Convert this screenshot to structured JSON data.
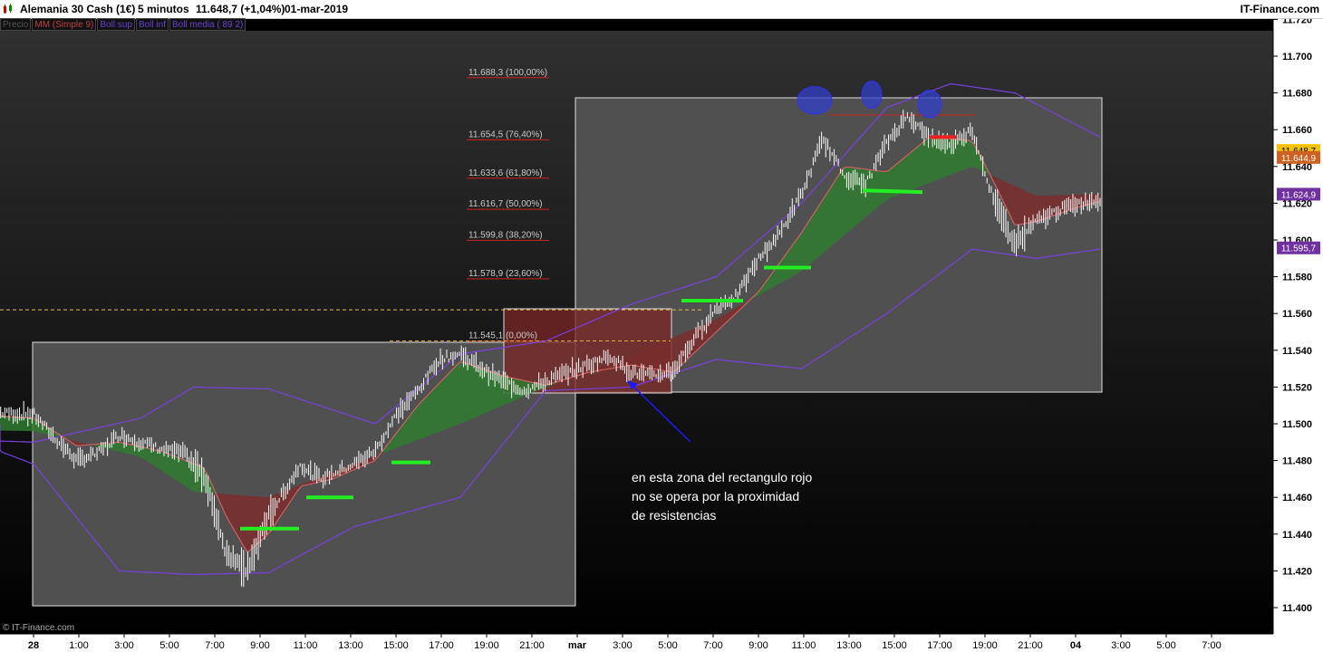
{
  "header": {
    "instrument": "Alemania 30 Cash (1€)",
    "timeframe": "5 minutos",
    "last": "11.648,7 (+1,04%)",
    "date": "01-mar-2019",
    "brand": "IT-Finance.com"
  },
  "legend": [
    {
      "label": "Precio",
      "color": "#555555"
    },
    {
      "label": "MM (Simple 9)",
      "color": "#c04040"
    },
    {
      "label": "Boll sup",
      "color": "#6a3fd0"
    },
    {
      "label": "Boll inf",
      "color": "#6a3fd0"
    },
    {
      "label": "Boll media ( 89 2)",
      "color": "#6a3fd0"
    }
  ],
  "copyright": "© IT-Finance.com",
  "chart_data": {
    "type": "line",
    "x_ticks": [
      "28",
      "1:00",
      "3:00",
      "5:00",
      "7:00",
      "9:00",
      "11:00",
      "13:00",
      "15:00",
      "17:00",
      "19:00",
      "21:00",
      "mar",
      "3:00",
      "5:00",
      "7:00",
      "9:00",
      "11:00",
      "13:00",
      "15:00",
      "17:00",
      "19:00",
      "21:00",
      "04",
      "3:00",
      "5:00",
      "7:00"
    ],
    "y_ticks": [
      "11.720",
      "11.700",
      "11.680",
      "11.660",
      "11.640",
      "11.620",
      "11.600",
      "11.580",
      "11.560",
      "11.540",
      "11.520",
      "11.500",
      "11.480",
      "11.460",
      "11.440",
      "11.420",
      "11.400"
    ],
    "ylim": [
      11400,
      11720
    ],
    "price_tags": [
      {
        "label": "11.648,7",
        "value": 11648.7,
        "bg": "#f2c200",
        "fg": "#000000"
      },
      {
        "label": "11.644,9",
        "value": 11644.9,
        "bg": "#d06020",
        "fg": "#ffffff"
      },
      {
        "label": "11.624,9",
        "value": 11624.9,
        "bg": "#7030a0",
        "fg": "#ffffff"
      },
      {
        "label": "11.595,7",
        "value": 11595.7,
        "bg": "#7030a0",
        "fg": "#ffffff"
      }
    ],
    "fibonacci": [
      {
        "price": 11688.3,
        "label": "11.688,3 (100,00%)"
      },
      {
        "price": 11654.5,
        "label": "11.654,5 (76,40%)"
      },
      {
        "price": 11633.6,
        "label": "11.633,6 (61,80%)"
      },
      {
        "price": 11616.7,
        "label": "11.616,7 (50,00%)"
      },
      {
        "price": 11599.8,
        "label": "11.599,8 (38,20%)"
      },
      {
        "price": 11578.9,
        "label": "11.578,9 (23,60%)"
      },
      {
        "price": 11545.1,
        "label": "11.545,1 (0,00%)"
      }
    ],
    "series": [
      {
        "name": "Precio",
        "color": "#ffffff",
        "x": [
          27.8,
          28.0,
          28.04,
          28.08,
          28.12,
          28.16,
          28.2,
          28.24,
          28.28,
          28.32,
          28.36,
          28.4,
          28.44,
          28.48,
          28.5,
          28.52,
          28.54,
          28.56,
          28.6,
          28.64,
          28.68,
          28.72,
          28.76,
          28.8,
          28.84,
          28.88,
          28.92,
          28.96,
          29.0,
          29.04,
          29.08,
          29.12,
          29.16,
          29.2,
          29.24,
          29.28,
          29.32,
          29.36,
          29.4,
          29.44,
          29.48,
          29.52,
          29.56,
          29.6,
          29.64,
          29.68,
          29.72,
          29.76,
          29.8,
          29.84,
          29.88,
          29.92,
          29.96,
          30.0
        ],
        "values": [
          11508,
          11505,
          11492,
          11480,
          11484,
          11494,
          11490,
          11486,
          11484,
          11472,
          11430,
          11420,
          11450,
          11468,
          11478,
          11473,
          11470,
          11473,
          11478,
          11485,
          11505,
          11518,
          11535,
          11538,
          11530,
          11523,
          11518,
          11523,
          11528,
          11532,
          11537,
          11528,
          11526,
          11529,
          11547,
          11563,
          11570,
          11590,
          11604,
          11625,
          11655,
          11635,
          11630,
          11653,
          11668,
          11655,
          11652,
          11660,
          11622,
          11598,
          11610,
          11616,
          11620,
          11622
        ]
      },
      {
        "name": "MM (Simple 9)",
        "color": "#d06060",
        "x": [
          27.8,
          28.0,
          28.08,
          28.16,
          28.24,
          28.32,
          28.36,
          28.4,
          28.44,
          28.5,
          28.56,
          28.64,
          28.72,
          28.8,
          28.88,
          28.96,
          29.04,
          29.12,
          29.2,
          29.28,
          29.36,
          29.44,
          29.52,
          29.6,
          29.68,
          29.76,
          29.8,
          29.84,
          29.88,
          29.96,
          30.0
        ],
        "values": [
          11507,
          11503,
          11488,
          11490,
          11485,
          11476,
          11450,
          11430,
          11440,
          11466,
          11470,
          11480,
          11510,
          11534,
          11526,
          11521,
          11528,
          11532,
          11528,
          11550,
          11572,
          11604,
          11640,
          11637,
          11656,
          11654,
          11632,
          11608,
          11610,
          11618,
          11621
        ]
      },
      {
        "name": "Boll sup",
        "color": "#7a40e0",
        "x": [
          27.8,
          28.0,
          28.2,
          28.3,
          28.44,
          28.64,
          28.8,
          28.96,
          29.12,
          29.28,
          29.44,
          29.6,
          29.72,
          29.84,
          30.0
        ],
        "values": [
          11492,
          11490,
          11503,
          11520,
          11519,
          11500,
          11538,
          11545,
          11565,
          11580,
          11620,
          11672,
          11685,
          11680,
          11656
        ]
      },
      {
        "name": "Boll inf",
        "color": "#7a40e0",
        "x": [
          27.8,
          28.0,
          28.16,
          28.3,
          28.44,
          28.6,
          28.8,
          28.96,
          29.12,
          29.28,
          29.44,
          29.6,
          29.76,
          29.88,
          30.0
        ],
        "values": [
          11500,
          11478,
          11420,
          11418,
          11419,
          11444,
          11460,
          11518,
          11520,
          11535,
          11530,
          11560,
          11595,
          11590,
          11595
        ]
      },
      {
        "name": "Boll media ( 89 2)",
        "color": "#6a3fd0",
        "x": [
          27.8,
          28.0,
          28.2,
          28.3,
          28.44,
          28.6,
          28.8,
          28.96,
          29.12,
          29.28,
          29.44,
          29.6,
          29.76,
          29.88,
          30.0
        ],
        "values": [
          11497,
          11496,
          11482,
          11463,
          11460,
          11478,
          11500,
          11520,
          11537,
          11557,
          11583,
          11622,
          11640,
          11624,
          11625
        ]
      }
    ],
    "annotation": [
      "en esta  zona  del rectangulo rojo",
      "no se opera por la proximidad",
      "de resistencias"
    ]
  }
}
